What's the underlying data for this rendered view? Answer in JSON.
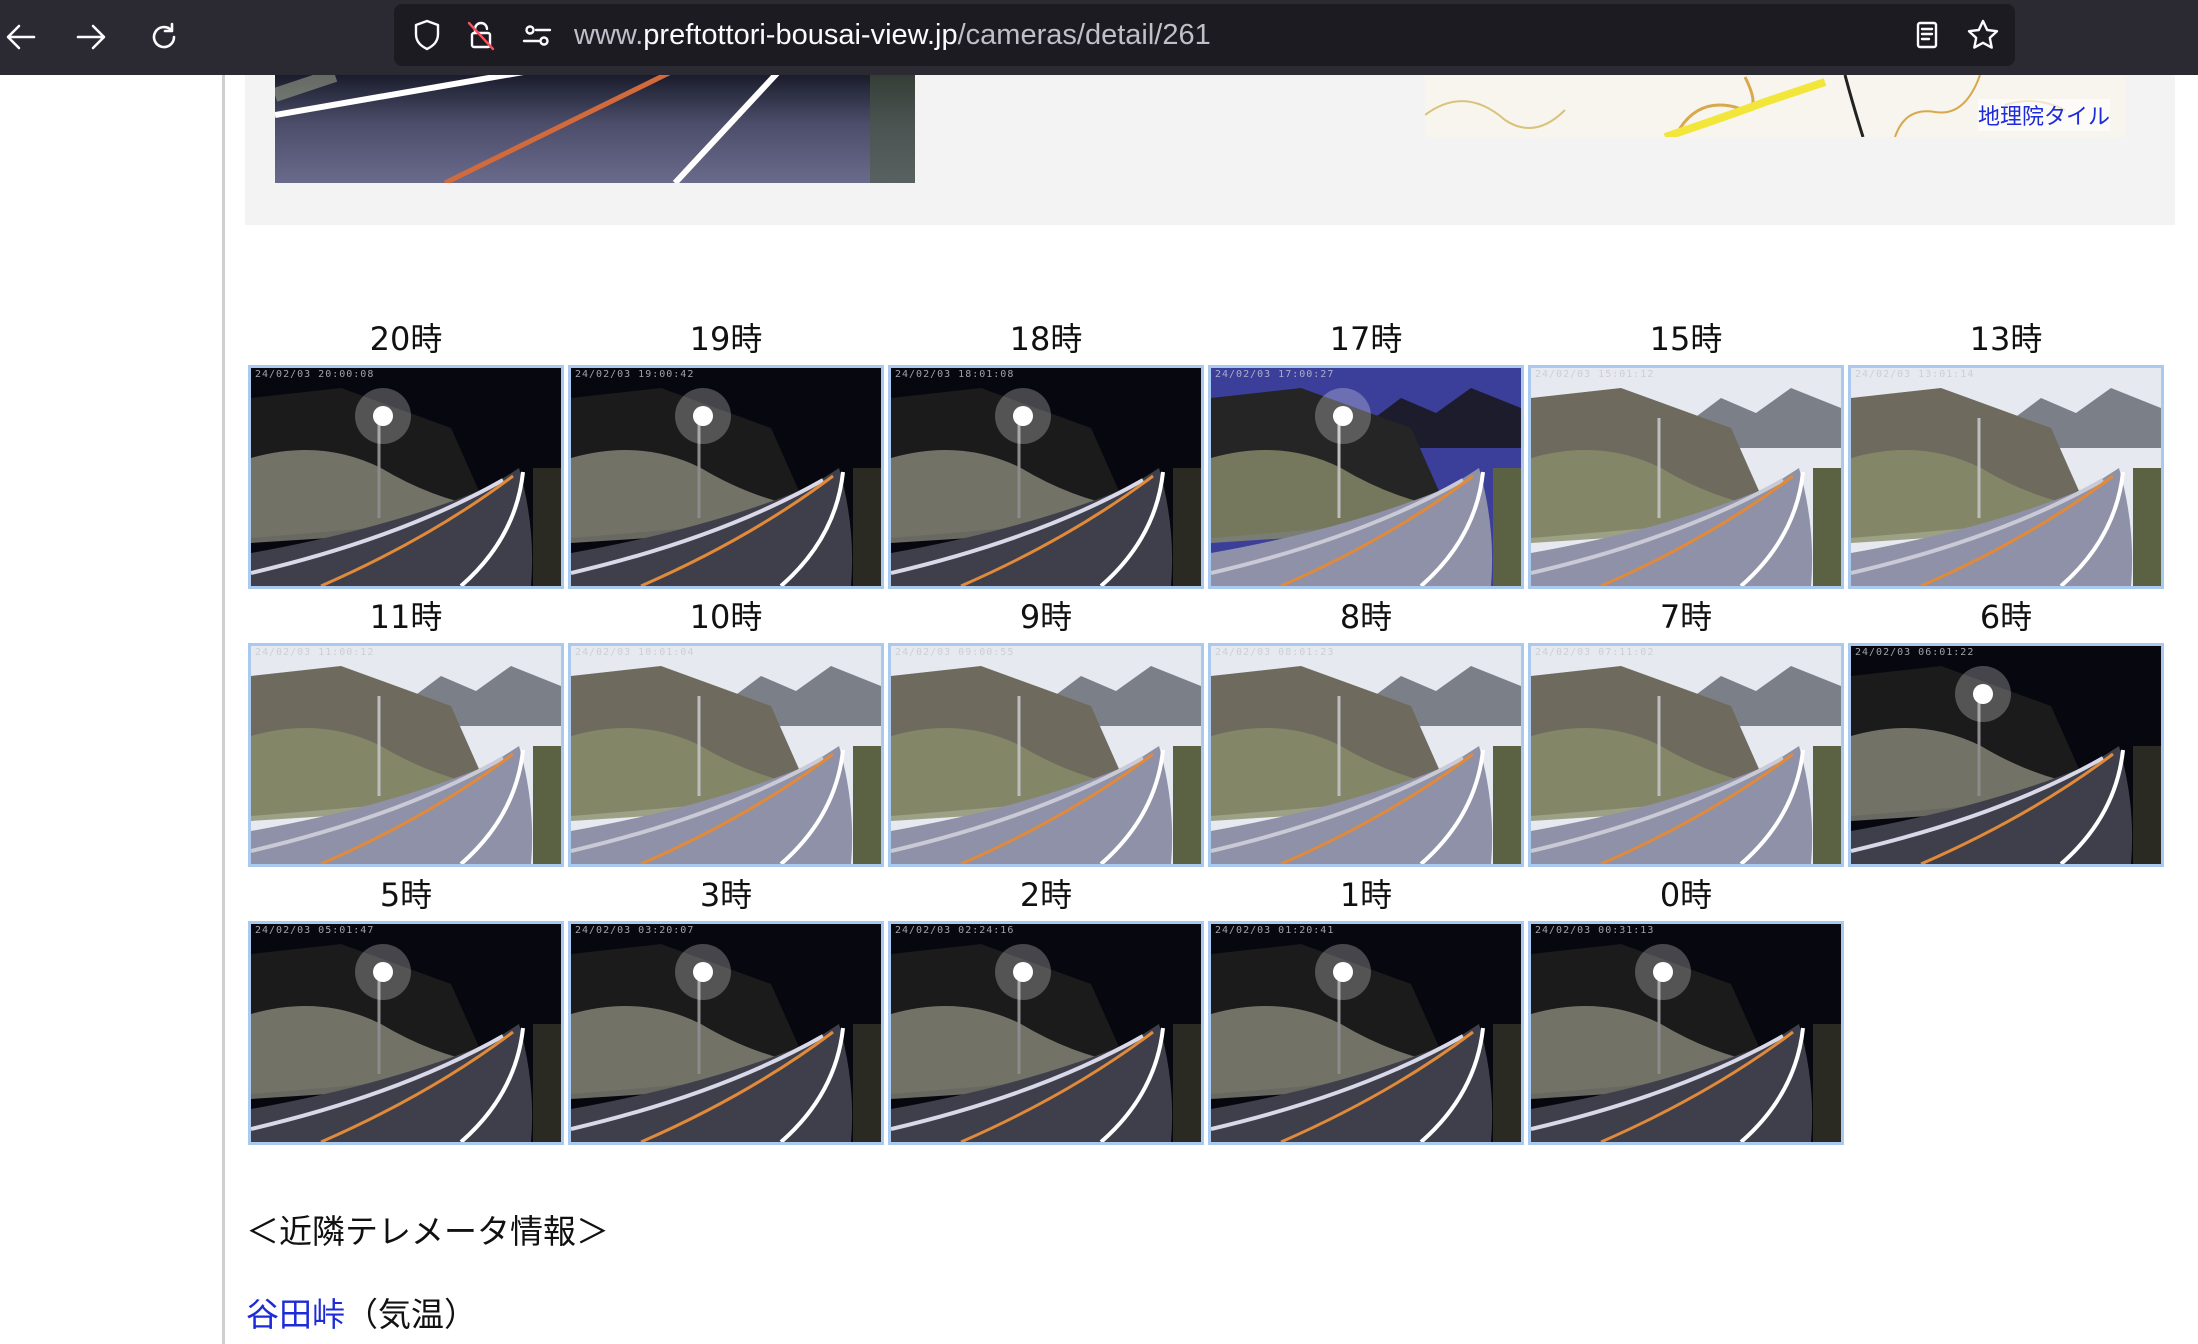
{
  "browser": {
    "url_prefix": "www.",
    "url_host": "preftottori-bousai-view.jp",
    "url_path": "/cameras/detail/261"
  },
  "map": {
    "attribution": "地理院タイル"
  },
  "thumbnails": [
    {
      "label": "20時",
      "stamp": "24/02/03 20:00:08",
      "scene": "night"
    },
    {
      "label": "19時",
      "stamp": "24/02/03 19:00:42",
      "scene": "night"
    },
    {
      "label": "18時",
      "stamp": "24/02/03 18:01:08",
      "scene": "night"
    },
    {
      "label": "17時",
      "stamp": "24/02/03 17:00:27",
      "scene": "dusk"
    },
    {
      "label": "15時",
      "stamp": "24/02/03 15:01:12",
      "scene": "day"
    },
    {
      "label": "13時",
      "stamp": "24/02/03 13:01:14",
      "scene": "day"
    },
    {
      "label": "11時",
      "stamp": "24/02/03 11:00:12",
      "scene": "day"
    },
    {
      "label": "10時",
      "stamp": "24/02/03 10:01:04",
      "scene": "day"
    },
    {
      "label": "9時",
      "stamp": "24/02/03 09:00:55",
      "scene": "day"
    },
    {
      "label": "8時",
      "stamp": "24/02/03 08:01:23",
      "scene": "day"
    },
    {
      "label": "7時",
      "stamp": "24/02/03 07:11:02",
      "scene": "day"
    },
    {
      "label": "6時",
      "stamp": "24/02/03 06:01:22",
      "scene": "night"
    },
    {
      "label": "5時",
      "stamp": "24/02/03 05:01:47",
      "scene": "night"
    },
    {
      "label": "3時",
      "stamp": "24/02/03 03:20:07",
      "scene": "night"
    },
    {
      "label": "2時",
      "stamp": "24/02/03 02:24:16",
      "scene": "night"
    },
    {
      "label": "1時",
      "stamp": "24/02/03 01:20:41",
      "scene": "night"
    },
    {
      "label": "0時",
      "stamp": "24/02/03 00:31:13",
      "scene": "night"
    }
  ],
  "telemeter": {
    "heading": "＜近隣テレメータ情報＞",
    "station_link": "谷田峠",
    "station_suffix": "（気温）"
  },
  "colors": {
    "toolbar": "#2b2a33",
    "urlbar": "#1c1b22",
    "thumb_border": "#a9c9ef",
    "link": "#1d2bd8"
  }
}
